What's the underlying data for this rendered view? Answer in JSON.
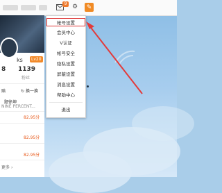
{
  "topbar": {
    "message_badge": "9",
    "icons": [
      "message-icon",
      "settings-icon",
      "compose-icon"
    ]
  },
  "profile": {
    "username_suffix": "ks",
    "level": "Lv20",
    "stats": [
      {
        "value": "8"
      },
      {
        "value": "1139",
        "label": "粉丝"
      }
    ],
    "switch_label": "换一换",
    "left_label": "赔",
    "list": [
      {
        "title": "题徐坤",
        "subtitle": "NINE PERCENT..."
      },
      {
        "score": "82.95分"
      },
      {
        "score": "82.95分"
      },
      {
        "score": "82.95分"
      }
    ],
    "more_label": "更多"
  },
  "menu": {
    "items": [
      "帐号设置",
      "会员中心",
      "V认证",
      "帐号安全",
      "隐私设置",
      "屏蔽设置",
      "消息设置",
      "帮助中心",
      "退出"
    ],
    "selected_index": 0
  },
  "colors": {
    "accent": "#f08a24",
    "highlight_border": "#dd3333",
    "arrow": "#e33a3a"
  }
}
